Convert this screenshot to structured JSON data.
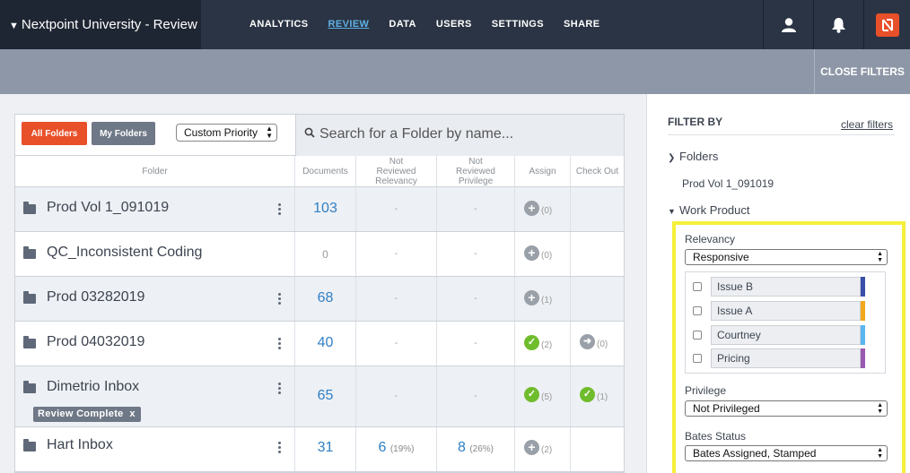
{
  "nav": {
    "brand": "Nextpoint University - Review",
    "links": [
      "ANALYTICS",
      "REVIEW",
      "DATA",
      "USERS",
      "SETTINGS",
      "SHARE"
    ],
    "active": "REVIEW"
  },
  "bar": {
    "close_filters": "CLOSE FILTERS"
  },
  "toolbar": {
    "all_folders": "All Folders",
    "my_folders": "My Folders",
    "priority": "Custom Priority",
    "search_placeholder": "Search for a Folder by name..."
  },
  "columns": {
    "folder": "Folder",
    "documents": "Documents",
    "not_reviewed_relevancy": "Not Reviewed Relevancy",
    "not_reviewed_privilege": "Not Reviewed Privilege",
    "assign": "Assign",
    "check_out": "Check Out"
  },
  "rows": [
    {
      "name": "Prod Vol 1_091019",
      "documents": "103",
      "nr_rel": "-",
      "nr_priv": "-",
      "assign": "(0)",
      "assign_icon": "plus-icon",
      "checkout": ""
    },
    {
      "name": "QC_Inconsistent Coding",
      "documents": "0",
      "nr_rel": "-",
      "nr_priv": "-",
      "assign": "(0)",
      "assign_icon": "plus-icon",
      "checkout": ""
    },
    {
      "name": "Prod 03282019",
      "documents": "68",
      "nr_rel": "-",
      "nr_priv": "-",
      "assign": "(1)",
      "assign_icon": "plus-icon",
      "checkout": ""
    },
    {
      "name": "Prod 04032019",
      "documents": "40",
      "nr_rel": "-",
      "nr_priv": "-",
      "assign": "(2)",
      "assign_icon": "check-icon",
      "checkout": "(0)",
      "checkout_icon": "arrow-right-icon"
    },
    {
      "name": "Dimetrio Inbox",
      "documents": "65",
      "nr_rel": "-",
      "nr_priv": "-",
      "assign": "(5)",
      "assign_icon": "check-icon",
      "checkout": "(1)",
      "checkout_icon": "check-icon",
      "badge": "Review Complete",
      "badge_x": "x"
    },
    {
      "name": "Hart Inbox",
      "documents": "31",
      "nr_rel": "6",
      "nr_rel_pct": "(19%)",
      "nr_priv": "8",
      "nr_priv_pct": "(26%)",
      "assign": "(2)",
      "assign_icon": "plus-icon",
      "checkout": ""
    }
  ],
  "filters": {
    "title": "FILTER BY",
    "clear": "clear filters",
    "folders_label": "Folders",
    "folder_value": "Prod Vol 1_091019",
    "work_product_label": "Work Product",
    "relevancy_label": "Relevancy",
    "relevancy_value": "Responsive",
    "issues": [
      {
        "label": "Issue B",
        "color": "#3a4fa8"
      },
      {
        "label": "Issue A",
        "color": "#f0a81c"
      },
      {
        "label": "Courtney",
        "color": "#5ab5ee"
      },
      {
        "label": "Pricing",
        "color": "#9a5ab0"
      }
    ],
    "privilege_label": "Privilege",
    "privilege_value": "Not Privileged",
    "bates_label": "Bates Status",
    "bates_value": "Bates Assigned, Stamped"
  },
  "colors": {
    "accent": "#e8502a",
    "highlight": "#f5f03a",
    "link": "#2f7fc4",
    "check": "#6fbc2c"
  }
}
